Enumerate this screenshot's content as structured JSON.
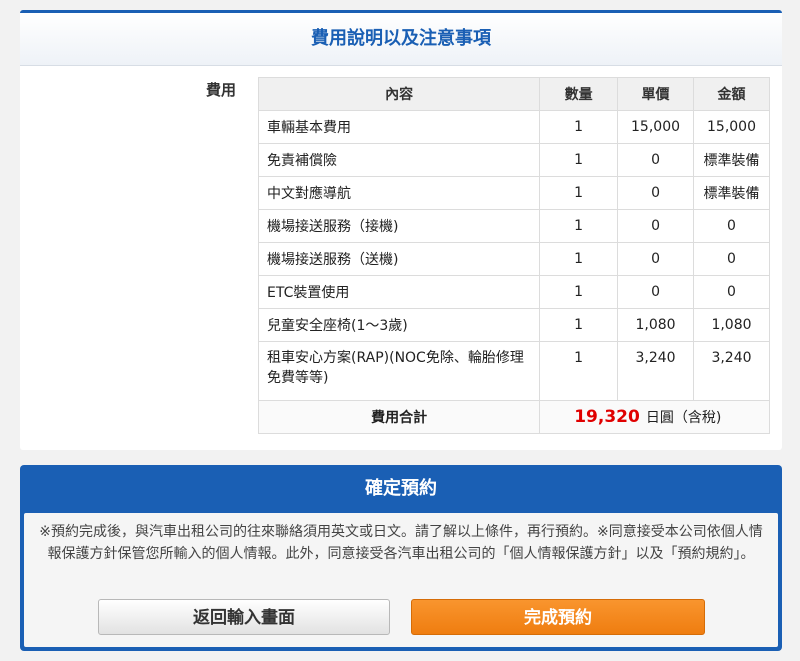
{
  "fee_section": {
    "title": "費用說明以及注意事項",
    "label": "費用",
    "columns": {
      "content": "內容",
      "qty": "數量",
      "unit_price": "單價",
      "amount": "金額"
    },
    "rows": [
      {
        "content": "車輛基本費用",
        "qty": "1",
        "unit_price": "15,000",
        "amount": "15,000"
      },
      {
        "content": "免責補償險",
        "qty": "1",
        "unit_price": "0",
        "amount": "標準裝備"
      },
      {
        "content": "中文對應導航",
        "qty": "1",
        "unit_price": "0",
        "amount": "標準裝備"
      },
      {
        "content": "機場接送服務（接機)",
        "qty": "1",
        "unit_price": "0",
        "amount": "0"
      },
      {
        "content": "機場接送服務（送機)",
        "qty": "1",
        "unit_price": "0",
        "amount": "0"
      },
      {
        "content": "ETC裝置使用",
        "qty": "1",
        "unit_price": "0",
        "amount": "0"
      },
      {
        "content": "兒童安全座椅(1～3歲)",
        "qty": "1",
        "unit_price": "1,080",
        "amount": "1,080"
      },
      {
        "content": "租車安心方案(RAP)(NOC免除、輪胎修理免費等等)",
        "qty": "1",
        "unit_price": "3,240",
        "amount": "3,240"
      }
    ],
    "total": {
      "label": "費用合計",
      "amount": "19,320",
      "unit": "日圓（含稅)"
    }
  },
  "confirm_section": {
    "title": "確定預約",
    "notice": "※預約完成後，與汽車出租公司的往來聯絡須用英文或日文。請了解以上條件，再行預約。※同意接受本公司依個人情報保護方針保管您所輸入的個人情報。此外，同意接受各汽車出租公司的「個人情報保護方針」以及「預約規約」。",
    "back_button": "返回輸入畫面",
    "complete_button": "完成預約"
  },
  "colors": {
    "primary": "#1a5fb4",
    "accent": "#f08a1f",
    "total": "#e00000"
  }
}
